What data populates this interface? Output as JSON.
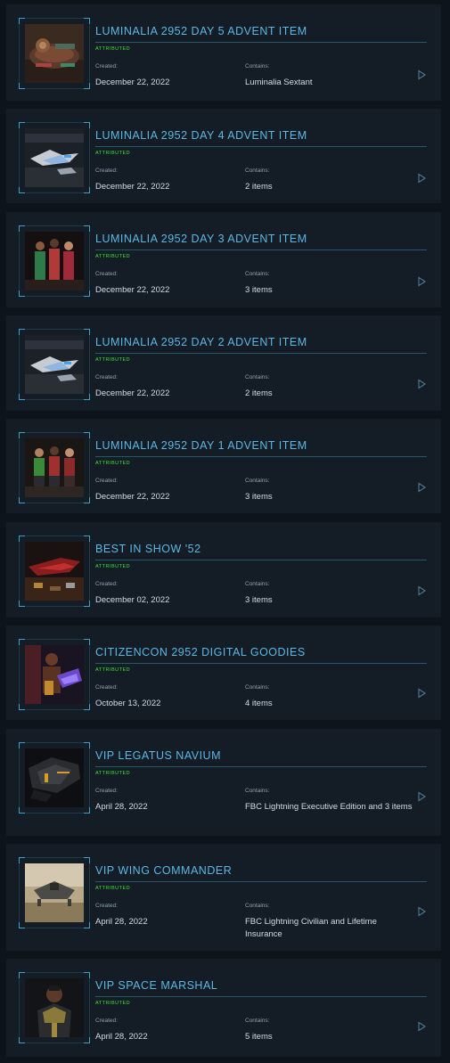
{
  "labels": {
    "created": "Created:",
    "contains": "Contains:"
  },
  "colors": {
    "title": "#5bb8e6",
    "status": "#39e632",
    "card_bg": "#141c25",
    "page_bg": "#0d141b"
  },
  "items": [
    {
      "title": "LUMINALIA 2952 DAY 5 ADVENT ITEM",
      "status": "ATTRIBUTED",
      "created": "December 22, 2022",
      "contains": "Luminalia Sextant",
      "thumb": "sextant-tray"
    },
    {
      "title": "LUMINALIA 2952 DAY 4 ADVENT ITEM",
      "status": "ATTRIBUTED",
      "created": "December 22, 2022",
      "contains": "2 items",
      "thumb": "hangar-ship"
    },
    {
      "title": "LUMINALIA 2952 DAY 3 ADVENT ITEM",
      "status": "ATTRIBUTED",
      "created": "December 22, 2022",
      "contains": "3 items",
      "thumb": "three-figures"
    },
    {
      "title": "LUMINALIA 2952 DAY 2 ADVENT ITEM",
      "status": "ATTRIBUTED",
      "created": "December 22, 2022",
      "contains": "2 items",
      "thumb": "hangar-ship"
    },
    {
      "title": "LUMINALIA 2952 DAY 1 ADVENT ITEM",
      "status": "ATTRIBUTED",
      "created": "December 22, 2022",
      "contains": "3 items",
      "thumb": "three-figures-sweaters"
    },
    {
      "title": "BEST IN SHOW '52",
      "status": "ATTRIBUTED",
      "created": "December 02, 2022",
      "contains": "3 items",
      "thumb": "red-ship"
    },
    {
      "title": "CITIZENCON 2952 DIGITAL GOODIES",
      "status": "ATTRIBUTED",
      "created": "October 13, 2022",
      "contains": "4 items",
      "thumb": "armored-character"
    },
    {
      "title": "VIP LEGATUS NAVIUM",
      "status": "ATTRIBUTED",
      "created": "April 28, 2022",
      "contains": "FBC Lightning Executive Edition and 3 items",
      "thumb": "black-gold-ship"
    },
    {
      "title": "VIP WING COMMANDER",
      "status": "ATTRIBUTED",
      "created": "April 28, 2022",
      "contains": "FBC Lightning Civilian and Lifetime Insurance",
      "thumb": "desert-ship"
    },
    {
      "title": "VIP SPACE MARSHAL",
      "status": "ATTRIBUTED",
      "created": "April 28, 2022",
      "contains": "5 items",
      "thumb": "armored-marshal"
    }
  ]
}
